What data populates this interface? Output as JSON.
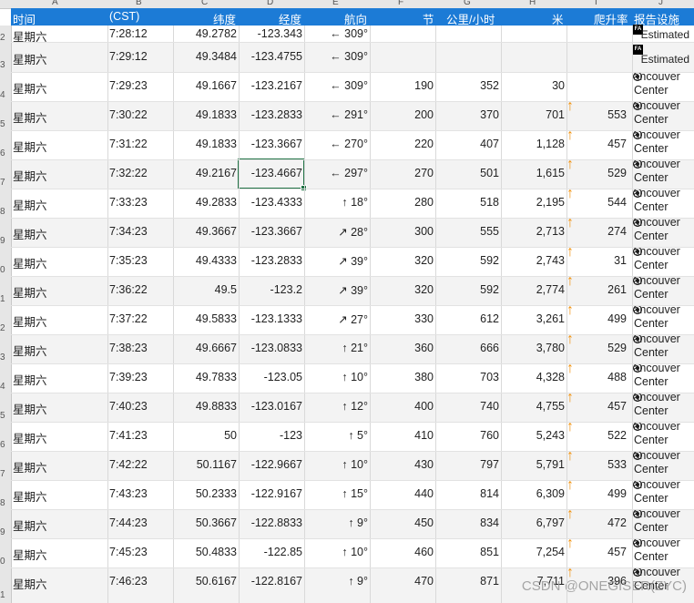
{
  "columns": [
    "A",
    "B",
    "C",
    "D",
    "E",
    "F",
    "G",
    "H",
    "I",
    "J"
  ],
  "headers": {
    "time": "时间",
    "cst": "(CST)",
    "lat": "纬度",
    "lon": "经度",
    "heading": "航向",
    "knots": "节",
    "kmh": "公里/小时",
    "meters": "米",
    "climb": "爬升率",
    "facility": "报告设施"
  },
  "row_numbers": [
    "2",
    "",
    "3",
    "4",
    "5",
    "6",
    "7",
    "8",
    "9",
    "0",
    "1",
    "2",
    "3",
    "4",
    "5",
    "6",
    "7",
    "8",
    "9",
    "0",
    "1"
  ],
  "rows": [
    {
      "day": "星期六",
      "time": "7:28:12",
      "lat": "49.2782",
      "lon": "-123.343",
      "heading": "← 309°",
      "knots": "",
      "kmh": "",
      "meters": "",
      "climb": "",
      "facility": "Estimated",
      "facility_icon": "FA",
      "up": false
    },
    {
      "day": "星期六",
      "time": "7:29:12",
      "lat": "49.3484",
      "lon": "-123.4755",
      "heading": "← 309°",
      "knots": "",
      "kmh": "",
      "meters": "",
      "climb": "",
      "facility": "Estimated",
      "facility_icon": "FA",
      "up": false
    },
    {
      "day": "星期六",
      "time": "7:29:23",
      "lat": "49.1667",
      "lon": "-123.2167",
      "heading": "← 309°",
      "knots": "190",
      "kmh": "352",
      "meters": "30",
      "climb": "",
      "facility": "Vancouver Center",
      "facility_icon": "radio",
      "up": false
    },
    {
      "day": "星期六",
      "time": "7:30:22",
      "lat": "49.1833",
      "lon": "-123.2833",
      "heading": "← 291°",
      "knots": "200",
      "kmh": "370",
      "meters": "701",
      "climb": "553",
      "facility": "Vancouver Center",
      "facility_icon": "radio",
      "up": true
    },
    {
      "day": "星期六",
      "time": "7:31:22",
      "lat": "49.1833",
      "lon": "-123.3667",
      "heading": "← 270°",
      "knots": "220",
      "kmh": "407",
      "meters": "1,128",
      "climb": "457",
      "facility": "Vancouver Center",
      "facility_icon": "radio",
      "up": true
    },
    {
      "day": "星期六",
      "time": "7:32:22",
      "lat": "49.2167",
      "lon": "-123.4667",
      "heading": "← 297°",
      "knots": "270",
      "kmh": "501",
      "meters": "1,615",
      "climb": "529",
      "facility": "Vancouver Center",
      "facility_icon": "radio",
      "up": true
    },
    {
      "day": "星期六",
      "time": "7:33:23",
      "lat": "49.2833",
      "lon": "-123.4333",
      "heading": "↑ 18°",
      "knots": "280",
      "kmh": "518",
      "meters": "2,195",
      "climb": "544",
      "facility": "Vancouver Center",
      "facility_icon": "radio",
      "up": true
    },
    {
      "day": "星期六",
      "time": "7:34:23",
      "lat": "49.3667",
      "lon": "-123.3667",
      "heading": "↗ 28°",
      "knots": "300",
      "kmh": "555",
      "meters": "2,713",
      "climb": "274",
      "facility": "Vancouver Center",
      "facility_icon": "radio",
      "up": true
    },
    {
      "day": "星期六",
      "time": "7:35:23",
      "lat": "49.4333",
      "lon": "-123.2833",
      "heading": "↗ 39°",
      "knots": "320",
      "kmh": "592",
      "meters": "2,743",
      "climb": "31",
      "facility": "Vancouver Center",
      "facility_icon": "radio",
      "up": true
    },
    {
      "day": "星期六",
      "time": "7:36:22",
      "lat": "49.5",
      "lon": "-123.2",
      "heading": "↗ 39°",
      "knots": "320",
      "kmh": "592",
      "meters": "2,774",
      "climb": "261",
      "facility": "Vancouver Center",
      "facility_icon": "radio",
      "up": true
    },
    {
      "day": "星期六",
      "time": "7:37:22",
      "lat": "49.5833",
      "lon": "-123.1333",
      "heading": "↗ 27°",
      "knots": "330",
      "kmh": "612",
      "meters": "3,261",
      "climb": "499",
      "facility": "Vancouver Center",
      "facility_icon": "radio",
      "up": true
    },
    {
      "day": "星期六",
      "time": "7:38:23",
      "lat": "49.6667",
      "lon": "-123.0833",
      "heading": "↑ 21°",
      "knots": "360",
      "kmh": "666",
      "meters": "3,780",
      "climb": "529",
      "facility": "Vancouver Center",
      "facility_icon": "radio",
      "up": true
    },
    {
      "day": "星期六",
      "time": "7:39:23",
      "lat": "49.7833",
      "lon": "-123.05",
      "heading": "↑ 10°",
      "knots": "380",
      "kmh": "703",
      "meters": "4,328",
      "climb": "488",
      "facility": "Vancouver Center",
      "facility_icon": "radio",
      "up": true
    },
    {
      "day": "星期六",
      "time": "7:40:23",
      "lat": "49.8833",
      "lon": "-123.0167",
      "heading": "↑ 12°",
      "knots": "400",
      "kmh": "740",
      "meters": "4,755",
      "climb": "457",
      "facility": "Vancouver Center",
      "facility_icon": "radio",
      "up": true
    },
    {
      "day": "星期六",
      "time": "7:41:23",
      "lat": "50",
      "lon": "-123",
      "heading": "↑ 5°",
      "knots": "410",
      "kmh": "760",
      "meters": "5,243",
      "climb": "522",
      "facility": "Vancouver Center",
      "facility_icon": "radio",
      "up": true
    },
    {
      "day": "星期六",
      "time": "7:42:22",
      "lat": "50.1167",
      "lon": "-122.9667",
      "heading": "↑ 10°",
      "knots": "430",
      "kmh": "797",
      "meters": "5,791",
      "climb": "533",
      "facility": "Vancouver Center",
      "facility_icon": "radio",
      "up": true
    },
    {
      "day": "星期六",
      "time": "7:43:23",
      "lat": "50.2333",
      "lon": "-122.9167",
      "heading": "↑ 15°",
      "knots": "440",
      "kmh": "814",
      "meters": "6,309",
      "climb": "499",
      "facility": "Vancouver Center",
      "facility_icon": "radio",
      "up": true
    },
    {
      "day": "星期六",
      "time": "7:44:23",
      "lat": "50.3667",
      "lon": "-122.8833",
      "heading": "↑ 9°",
      "knots": "450",
      "kmh": "834",
      "meters": "6,797",
      "climb": "472",
      "facility": "Vancouver Center",
      "facility_icon": "radio",
      "up": true
    },
    {
      "day": "星期六",
      "time": "7:45:23",
      "lat": "50.4833",
      "lon": "-122.85",
      "heading": "↑ 10°",
      "knots": "460",
      "kmh": "851",
      "meters": "7,254",
      "climb": "457",
      "facility": "Vancouver Center",
      "facility_icon": "radio",
      "up": true
    },
    {
      "day": "星期六",
      "time": "7:46:23",
      "lat": "50.6167",
      "lon": "-122.8167",
      "heading": "↑ 9°",
      "knots": "470",
      "kmh": "871",
      "meters": "7,711",
      "climb": "396",
      "facility": "Vancouver Center",
      "facility_icon": "radio",
      "up": true
    }
  ],
  "watermark": "CSDN @ONEGISER(ZYC)",
  "colors": {
    "header_bg": "#1c7bd6",
    "selection": "#217346",
    "arrow": "#f0900b"
  }
}
